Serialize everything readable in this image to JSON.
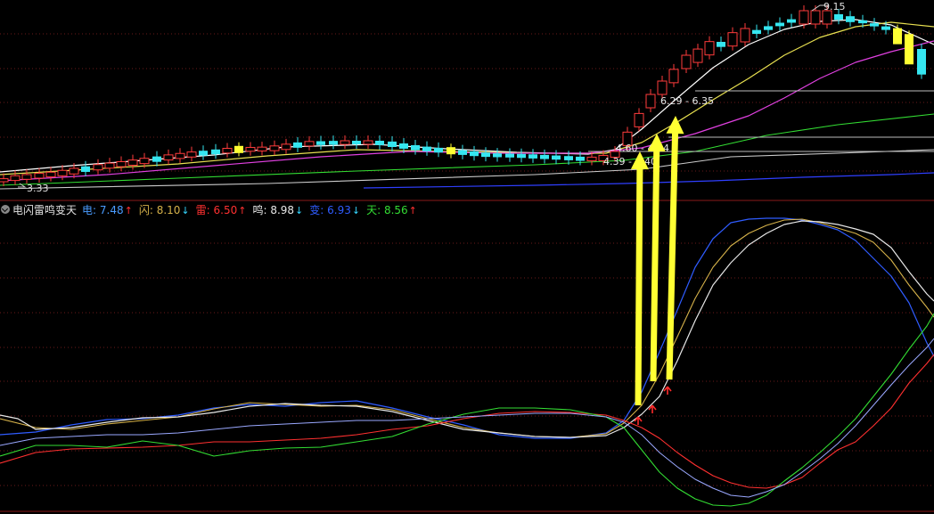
{
  "indicator": {
    "name": "电闪雷鸣变天",
    "items": [
      {
        "label": "电",
        "value": "7.48",
        "arrow": "↑",
        "color": "#4a9cff",
        "arrow_color": "#ff3030"
      },
      {
        "label": "闪",
        "value": "8.10",
        "arrow": "↓",
        "color": "#d6b24a",
        "arrow_color": "#35d6ff"
      },
      {
        "label": "雷",
        "value": "6.50",
        "arrow": "↑",
        "color": "#ff3030",
        "arrow_color": "#ff3030"
      },
      {
        "label": "鸣",
        "value": "8.98",
        "arrow": "↓",
        "color": "#e8e8e8",
        "arrow_color": "#35d6ff"
      },
      {
        "label": "变",
        "value": "6.93",
        "arrow": "↓",
        "color": "#2f5cff",
        "arrow_color": "#35d6ff"
      },
      {
        "label": "天",
        "value": "8.56",
        "arrow": "↑",
        "color": "#33dd33",
        "arrow_color": "#ff3030"
      }
    ]
  },
  "colors": {
    "background": "#000000",
    "up_candle": "#ff3b3b",
    "down_candle": "#35e6f0",
    "highlight_candle": "#ffff33",
    "grid": "#6a1a1a",
    "annotation_arrow": "#ffff33"
  },
  "chart_data": [
    {
      "type": "candlestick",
      "price_labels": {
        "high": "9.15",
        "low": "3.33"
      },
      "annotations": [
        "4.60 - 4.64",
        "6.29 - 6.35",
        "4.39 - 4.40"
      ],
      "grid": true
    },
    {
      "type": "line",
      "series": [
        {
          "name": "电",
          "color": "#2f5cff"
        },
        {
          "name": "闪",
          "color": "#d6b24a"
        },
        {
          "name": "雷",
          "color": "#ff3030"
        },
        {
          "name": "鸣",
          "color": "#e8e8e8"
        },
        {
          "name": "变",
          "color": "#2f5cff"
        },
        {
          "name": "天",
          "color": "#33dd33"
        }
      ],
      "signal_markers": 3,
      "grid": true
    }
  ]
}
